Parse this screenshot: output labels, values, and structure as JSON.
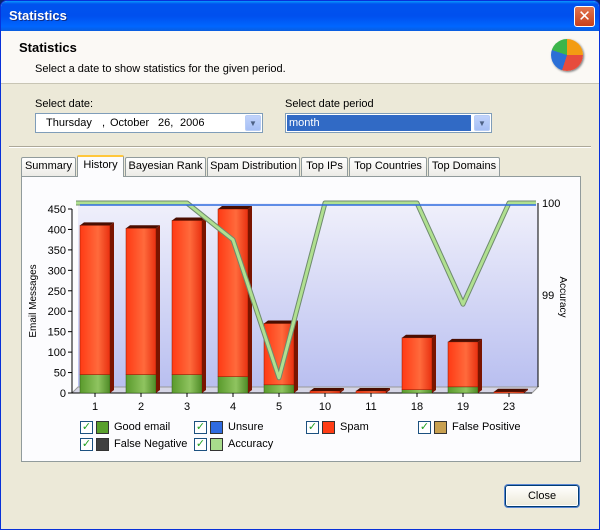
{
  "window": {
    "title": "Statistics",
    "close_glyph": "✕"
  },
  "header": {
    "title": "Statistics",
    "subtitle": "Select a date to show statistics for the given period.",
    "logo_icon": "app-logo-icon"
  },
  "date": {
    "label": "Select date:",
    "day": "Thursday",
    "sep": ",",
    "month": "October",
    "date": "26,",
    "year": "2006"
  },
  "period": {
    "label": "Select date period",
    "value": "month"
  },
  "tabs": [
    {
      "label": "Summary"
    },
    {
      "label": "History"
    },
    {
      "label": "Bayesian Rank"
    },
    {
      "label": "Spam Distribution"
    },
    {
      "label": "Top IPs"
    },
    {
      "label": "Top Countries"
    },
    {
      "label": "Top Domains"
    }
  ],
  "chart_data": {
    "type": "bar",
    "categories": [
      "1",
      "2",
      "3",
      "4",
      "5",
      "10",
      "11",
      "18",
      "19",
      "23"
    ],
    "ylabel": "Email Messages",
    "y2label": "Accuracy",
    "ylim": [
      0,
      450
    ],
    "yticks": [
      "0",
      "50",
      "100",
      "150",
      "200",
      "250",
      "300",
      "350",
      "400",
      "450"
    ],
    "y2ticks": [
      "99",
      "100"
    ],
    "series": [
      {
        "name": "Good email",
        "color": "#6fa83a",
        "values": [
          45,
          45,
          45,
          40,
          20,
          0,
          0,
          8,
          15,
          0
        ]
      },
      {
        "name": "Spam",
        "color": "#ff4a1c",
        "values": [
          365,
          358,
          377,
          410,
          150,
          5,
          5,
          127,
          110,
          3
        ]
      },
      {
        "name": "Accuracy",
        "color": "#b0e090",
        "values": [
          100,
          100,
          100,
          99.6,
          98.1,
          100,
          100,
          100,
          98.9,
          100
        ]
      }
    ]
  },
  "legend": [
    {
      "label": "Good email",
      "color": "#5aa02c",
      "checked": "✓"
    },
    {
      "label": "Unsure",
      "color": "#2f6be0",
      "checked": "✓"
    },
    {
      "label": "Spam",
      "color": "#ff3c14",
      "checked": "✓"
    },
    {
      "label": "False Positive",
      "color": "#c8a050",
      "checked": "✓"
    },
    {
      "label": "False Negative",
      "color": "#404040",
      "checked": "✓"
    },
    {
      "label": "Accuracy",
      "color": "#a8dc8c",
      "checked": "✓"
    }
  ],
  "close_label": "Close"
}
